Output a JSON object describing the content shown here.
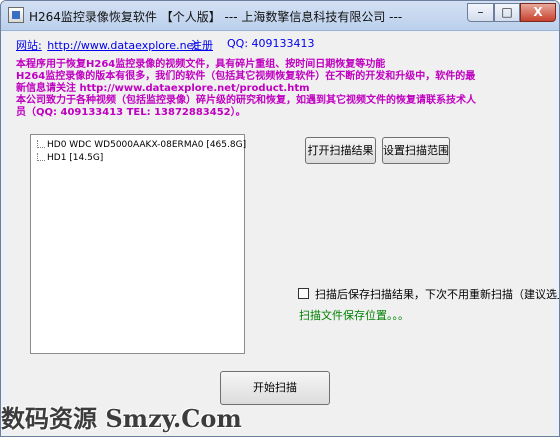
{
  "window": {
    "title": "H264监控录像恢复软件 【个人版】 --- 上海数擎信息科技有限公司 ---",
    "controls": {
      "minimize": "–",
      "maximize": "□",
      "close": "X"
    }
  },
  "header": {
    "site_label": "网站:",
    "site_url": "http://www.dataexplore.net",
    "register": "注册",
    "qq": "QQ:  409133413"
  },
  "info_lines": [
    "本程序用于恢复H264监控录像的视频文件，具有碎片重组、按时间日期恢复等功能",
    "H264监控录像的版本有很多，我们的软件（包括其它视频恢复软件）在不断的开发和升级中，软件的最",
    "新信息请关注 http://www.dataexplore.net/product.htm",
    "本公司致力于各种视频（包括监控录像）碎片级的研究和恢复，如遇到其它视频文件的恢复请联系技术人",
    "员（QQ: 409133413  TEL: 13872883452）。"
  ],
  "drives": [
    {
      "label": "HD0  WDC WD5000AAKX-08ERMA0  [465.8G]"
    },
    {
      "label": "HD1    [14.5G]"
    }
  ],
  "buttons": {
    "open_results": "打开扫描结果",
    "set_range": "设置扫描范围",
    "start_scan": "开始扫描"
  },
  "options": {
    "save_after_scan": "扫描后保存扫描结果，下次不用重新扫描（建议选上）",
    "save_after_scan_checked": false,
    "save_location": "扫描文件保存位置。。。"
  },
  "watermark": "数码资源 Smzy.Com"
}
